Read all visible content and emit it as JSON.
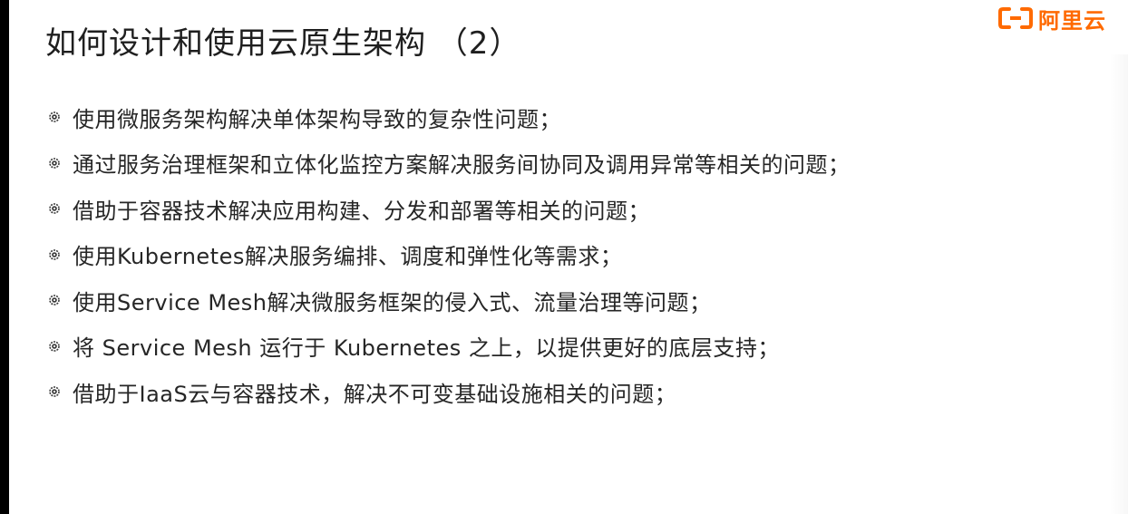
{
  "slide": {
    "title": "如何设计和使用云原生架构 （2）",
    "logo": {
      "text": "阿里云",
      "icon": "aliyun-bracket-icon",
      "color": "#ff6a00"
    },
    "bullet_icon": "gear-bullet-icon",
    "bullets": [
      "使用微服务架构解决单体架构导致的复杂性问题；",
      "通过服务治理框架和立体化监控方案解决服务间协同及调用异常等相关的问题；",
      "借助于容器技术解决应用构建、分发和部署等相关的问题；",
      "使用Kubernetes解决服务编排、调度和弹性化等需求；",
      "使用Service Mesh解决微服务框架的侵入式、流量治理等问题；",
      "将 Service Mesh 运行于 Kubernetes 之上，以提供更好的底层支持；",
      "借助于IaaS云与容器技术，解决不可变基础设施相关的问题；"
    ]
  }
}
